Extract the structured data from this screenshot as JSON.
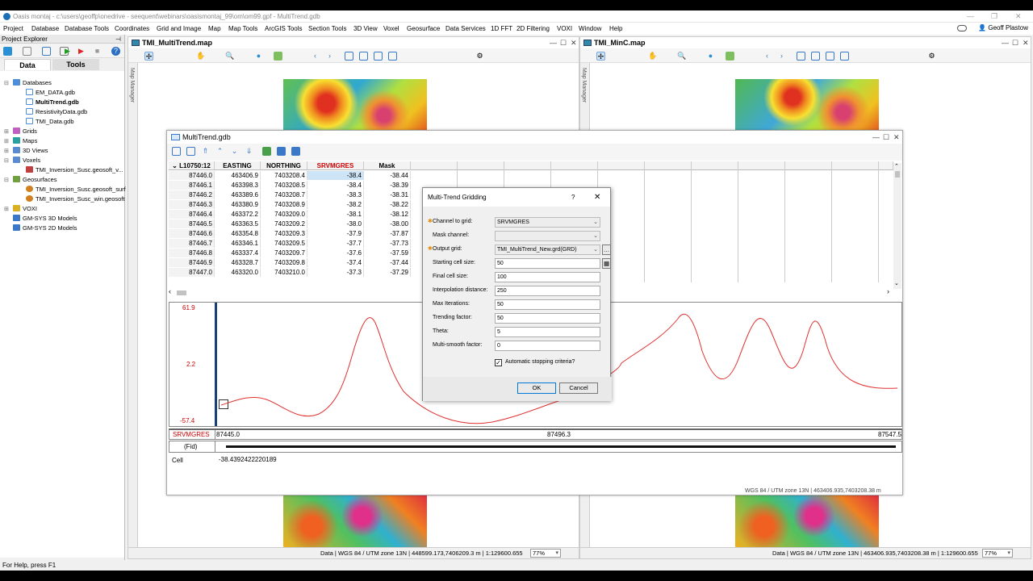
{
  "app": {
    "title": "Oasis montaj - c:\\users\\geoffp\\onedrive - seequent\\webinars\\oasismontaj_99\\om\\om99.gpf - MultiTrend.gdb",
    "user": "Geoff Plastow"
  },
  "menu": [
    "Project",
    "Database",
    "Database Tools",
    "Coordinates",
    "Grid and Image",
    "Map",
    "Map Tools",
    "ArcGIS Tools",
    "Section Tools",
    "3D View",
    "Voxel",
    "Geosurface",
    "Data Services",
    "1D FFT",
    "2D Filtering",
    "VOXI",
    "Window",
    "Help"
  ],
  "explorer": {
    "title": "Project Explorer",
    "tabs": {
      "data": "Data",
      "tools": "Tools"
    },
    "tree": {
      "databases": "Databases",
      "db_items": [
        "EM_DATA.gdb",
        "MultiTrend.gdb",
        "ResistivityData.gdb",
        "TMI_Data.gdb"
      ],
      "grids": "Grids",
      "maps": "Maps",
      "views3d": "3D Views",
      "voxels": "Voxels",
      "voxel_items": [
        "TMI_Inversion_Susc.geosoft_v..."
      ],
      "geosurfaces": "Geosurfaces",
      "geosurface_items": [
        "TMI_Inversion_Susc.geosoft_surf",
        "TMI_Inversion_Susc_win.geosoft"
      ],
      "voxi": "VOXI",
      "gmsys3d": "GM-SYS 3D Models",
      "gmsys2d": "GM-SYS 2D Models"
    }
  },
  "maps": {
    "left": {
      "title": "TMI_MultiTrend.map",
      "status": "Data  |  WGS 84 / UTM zone 13N  |  448599.173,7406209.3 m  |  1:129600.655",
      "zoom": "77%"
    },
    "right": {
      "title": "TMI_MinC.map",
      "status": "Data  |  WGS 84 / UTM zone 13N  |  463406.935,7403208.38 m  |  1:129600.655",
      "zoom": "77%"
    },
    "manager_label": "Map Manager"
  },
  "database": {
    "title": "MultiTrend.gdb",
    "line_header": "L10750:12",
    "columns": [
      "EASTING",
      "NORTHING",
      "SRVMGRES",
      "Mask"
    ],
    "rows": [
      [
        "87446.0",
        "463406.9",
        "7403208.4",
        "-38.4",
        "-38.44"
      ],
      [
        "87446.1",
        "463398.3",
        "7403208.5",
        "-38.4",
        "-38.39"
      ],
      [
        "87446.2",
        "463389.6",
        "7403208.7",
        "-38.3",
        "-38.31"
      ],
      [
        "87446.3",
        "463380.9",
        "7403208.9",
        "-38.2",
        "-38.22"
      ],
      [
        "87446.4",
        "463372.2",
        "7403209.0",
        "-38.1",
        "-38.12"
      ],
      [
        "87446.5",
        "463363.5",
        "7403209.2",
        "-38.0",
        "-38.00"
      ],
      [
        "87446.6",
        "463354.8",
        "7403209.3",
        "-37.9",
        "-37.87"
      ],
      [
        "87446.7",
        "463346.1",
        "7403209.5",
        "-37.7",
        "-37.73"
      ],
      [
        "87446.8",
        "463337.4",
        "7403209.7",
        "-37.6",
        "-37.59"
      ],
      [
        "87446.9",
        "463328.7",
        "7403209.8",
        "-37.4",
        "-37.44"
      ],
      [
        "87447.0",
        "463320.0",
        "7403210.0",
        "-37.3",
        "-37.29"
      ]
    ],
    "profile": {
      "y_max": "61.9",
      "y_mid": "2.2",
      "y_min": "-57.4",
      "channel": "SRVMGRES",
      "fid_label": "(Fid)",
      "fid_start": "87445.0",
      "fid_mid": "87496.3",
      "fid_end": "87547.5",
      "cell_label": "Cell",
      "cell_value": "-38.4392422220189"
    },
    "status": "WGS 84 / UTM zone 13N  |  463406.935,7403208.38 m"
  },
  "dialog": {
    "title": "Multi-Trend Gridding",
    "help": "?",
    "close": "✕",
    "fields": [
      {
        "label": "Channel to grid:",
        "value": "SRVMGRES",
        "required": true,
        "dropdown": true
      },
      {
        "label": "Mask channel:",
        "value": "",
        "required": false,
        "dropdown": true
      },
      {
        "label": "Output grid:",
        "value": "TMI_MultiTrend_New.grd(GRD)",
        "required": true,
        "dropdown": true
      },
      {
        "label": "Starting cell size:",
        "value": "50",
        "required": false,
        "dropdown": false
      },
      {
        "label": "Final cell size:",
        "value": "100",
        "required": false,
        "dropdown": false
      },
      {
        "label": "Interpolation distance:",
        "value": "250",
        "required": false,
        "dropdown": false
      },
      {
        "label": "Max Iterations:",
        "value": "50",
        "required": false,
        "dropdown": false
      },
      {
        "label": "Trending factor:",
        "value": "50",
        "required": false,
        "dropdown": false
      },
      {
        "label": "Theta:",
        "value": "5",
        "required": false,
        "dropdown": false
      },
      {
        "label": "Multi-smooth factor:",
        "value": "0",
        "required": false,
        "dropdown": false
      }
    ],
    "checkbox_label": "Automatic stopping criteria?",
    "ok": "OK",
    "cancel": "Cancel"
  },
  "statusbar": "For Help, press F1",
  "colors": {
    "accent": "#0078d7",
    "channel_red": "#cc0000",
    "profile_line": "#e03030"
  }
}
